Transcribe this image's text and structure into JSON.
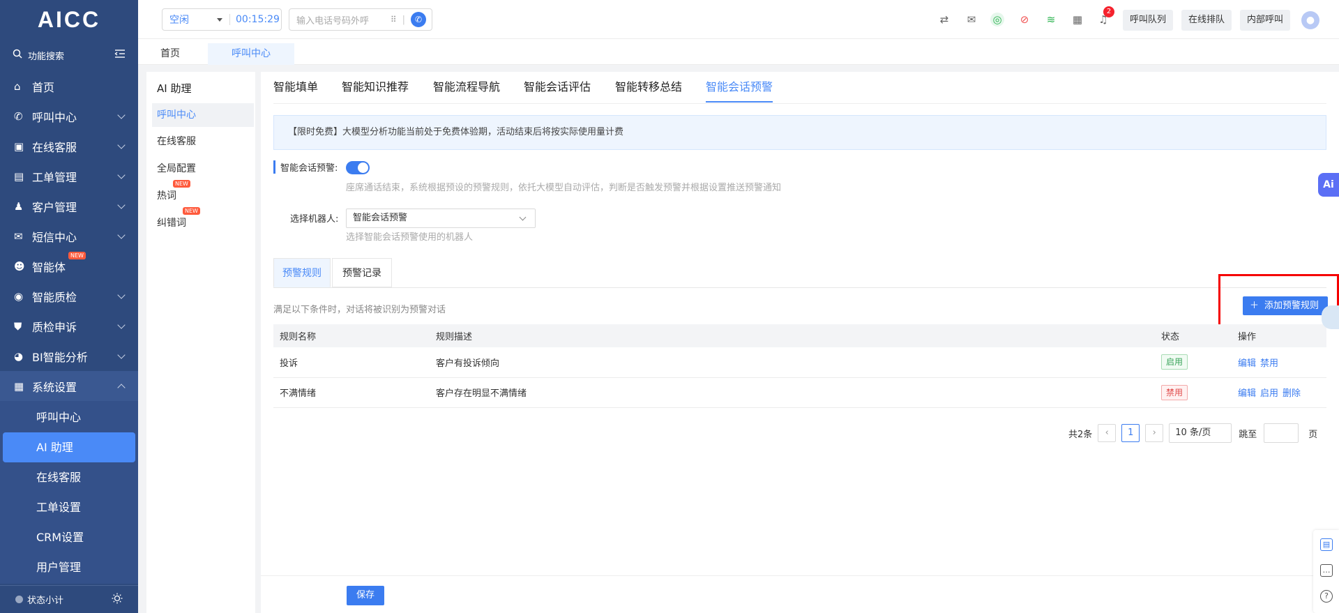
{
  "app": {
    "logo": "AICC"
  },
  "sidebar": {
    "search_label": "功能搜索",
    "items": [
      {
        "label": "首页",
        "icon": "home-icon",
        "chevron": false
      },
      {
        "label": "呼叫中心",
        "icon": "phone-icon",
        "chevron": true
      },
      {
        "label": "在线客服",
        "icon": "chat-icon",
        "chevron": true
      },
      {
        "label": "工单管理",
        "icon": "clipboard-icon",
        "chevron": true
      },
      {
        "label": "客户管理",
        "icon": "users-icon",
        "chevron": true
      },
      {
        "label": "短信中心",
        "icon": "mail-icon",
        "chevron": true
      },
      {
        "label": "智能体",
        "icon": "robot-icon",
        "chevron": false,
        "badge": "NEW"
      },
      {
        "label": "智能质检",
        "icon": "quality-icon",
        "chevron": true
      },
      {
        "label": "质检申诉",
        "icon": "shield-icon",
        "chevron": true
      },
      {
        "label": "BI智能分析",
        "icon": "pie-chart-icon",
        "chevron": true
      },
      {
        "label": "系统设置",
        "icon": "grid-icon",
        "chevron": true,
        "open": true
      }
    ],
    "sub_items": [
      "呼叫中心",
      "AI 助理",
      "在线客服",
      "工单设置",
      "CRM设置",
      "用户管理"
    ],
    "active_sub": "AI 助理",
    "status_label": "状态小计"
  },
  "topbar": {
    "status": "空闲",
    "timer": "00:15:29",
    "dial_placeholder": "输入电话号码外呼",
    "notification_count": "2",
    "buttons": [
      "呼叫队列",
      "在线排队",
      "内部呼叫"
    ]
  },
  "page_tabs": [
    "首页",
    "呼叫中心"
  ],
  "left_panel": {
    "title": "AI 助理",
    "items": [
      {
        "label": "呼叫中心",
        "active": true
      },
      {
        "label": "在线客服"
      },
      {
        "label": "全局配置"
      },
      {
        "label": "热词",
        "badge": "NEW"
      },
      {
        "label": "纠错词",
        "badge": "NEW"
      }
    ]
  },
  "feature_tabs": [
    "智能填单",
    "智能知识推荐",
    "智能流程导航",
    "智能会话评估",
    "智能转移总结",
    "智能会话预警"
  ],
  "active_feature_tab": "智能会话预警",
  "notice": "【限时免费】大模型分析功能当前处于免费体验期，活动结束后将按实际使用量计费",
  "form": {
    "warning_label": "智能会话预警:",
    "warning_enabled": true,
    "warning_hint": "座席通话结束，系统根据预设的预警规则，依托大模型自动评估，判断是否触发预警并根据设置推送预警通知",
    "robot_label": "选择机器人:",
    "robot_value": "智能会话预警",
    "robot_hint": "选择智能会话预警使用的机器人"
  },
  "content_tabs": [
    "预警规则",
    "预警记录"
  ],
  "rules_caption": "满足以下条件时，对话将被识别为预警对话",
  "add_rule_button": "添加预警规则",
  "table": {
    "headers": [
      "规则名称",
      "规则描述",
      "状态",
      "操作"
    ],
    "rows": [
      {
        "name": "投诉",
        "desc": "客户有投诉倾向",
        "status": "启用",
        "status_on": true,
        "ops": [
          "编辑",
          "禁用"
        ]
      },
      {
        "name": "不满情绪",
        "desc": "客户存在明显不满情绪",
        "status": "禁用",
        "status_on": false,
        "ops": [
          "编辑",
          "启用",
          "删除"
        ]
      }
    ]
  },
  "pager": {
    "total": "共2条",
    "current": "1",
    "page_size": "10 条/页",
    "jump_label": "跳至",
    "page_unit": "页"
  },
  "save_button": "保存",
  "ai_float": "Ai"
}
